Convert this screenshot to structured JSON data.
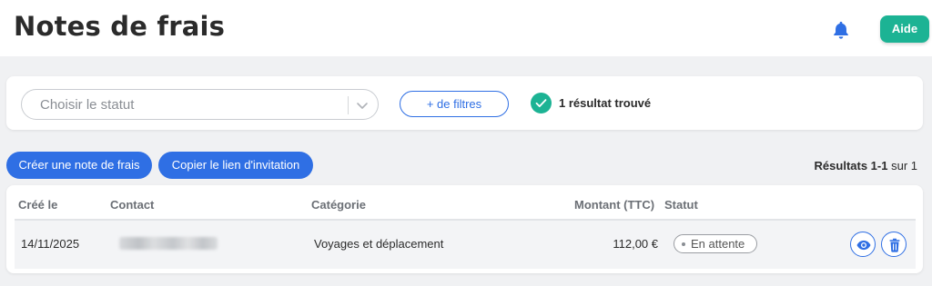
{
  "header": {
    "title": "Notes de frais",
    "help_label": "Aide",
    "bell_icon": "bell-icon"
  },
  "filters": {
    "status_placeholder": "Choisir le statut",
    "more_filters_label": "+ de filtres",
    "result_count_text": "1 résultat trouvé"
  },
  "actions": {
    "create_label": "Créer une note de frais",
    "copy_link_label": "Copier le lien d'invitation"
  },
  "pagination": {
    "results_label": "Résultats 1-1",
    "total_label": "sur 1"
  },
  "table": {
    "columns": {
      "created": "Créé le",
      "contact": "Contact",
      "category": "Catégorie",
      "amount": "Montant (TTC)",
      "status": "Statut"
    },
    "rows": [
      {
        "created": "14/11/2025",
        "contact": "",
        "category": "Voyages et déplacement",
        "amount": "112,00 €",
        "status": "En attente"
      }
    ]
  },
  "colors": {
    "primary": "#2f6fe4",
    "success": "#1cb394",
    "background": "#f0f1f3"
  }
}
